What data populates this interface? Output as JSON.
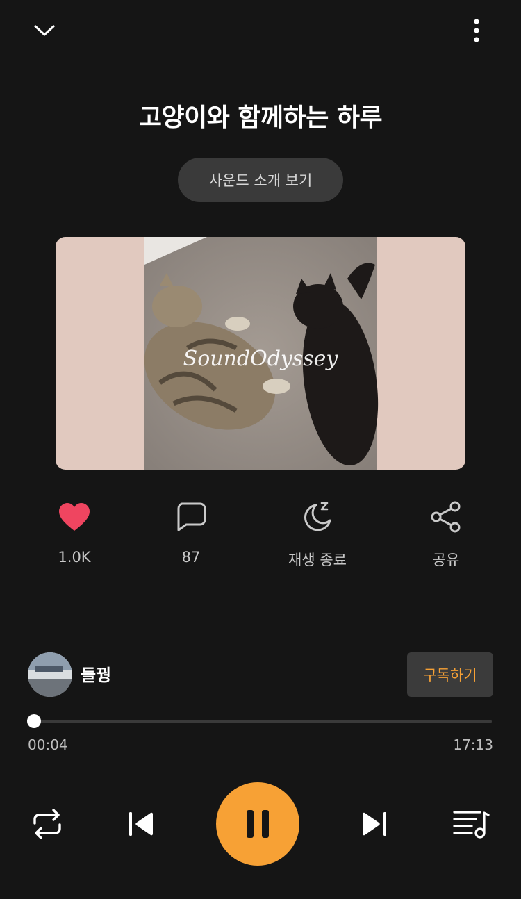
{
  "track": {
    "title": "고양이와 함께하는 하루",
    "intro_button": "사운드 소개 보기",
    "cover_watermark": "SoundOdyssey"
  },
  "actions": {
    "like_count": "1.0K",
    "comment_count": "87",
    "sleep_label": "재생 종료",
    "share_label": "공유"
  },
  "creator": {
    "name": "들꿩",
    "subscribe_label": "구독하기"
  },
  "playback": {
    "current_time": "00:04",
    "total_time": "17:13",
    "progress_fraction": 0.004,
    "state": "playing"
  },
  "colors": {
    "background": "#151515",
    "accent": "#f7a135",
    "like": "#ef4560"
  },
  "icons": {
    "collapse": "chevron-down-icon",
    "more": "more-vertical-icon",
    "like": "heart-icon",
    "comment": "comment-icon",
    "sleep": "moon-sleep-icon",
    "share": "share-icon",
    "repeat": "repeat-icon",
    "prev": "skip-previous-icon",
    "pause": "pause-icon",
    "next": "skip-next-icon",
    "playlist": "playlist-icon"
  }
}
